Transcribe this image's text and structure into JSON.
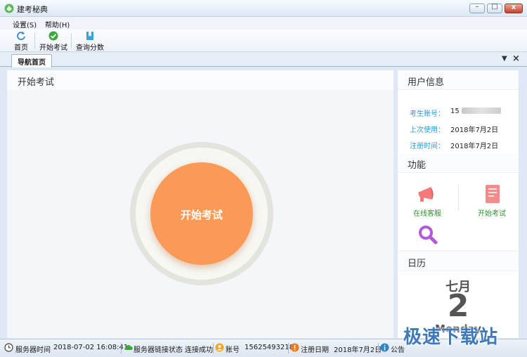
{
  "window": {
    "title": "建考秘典"
  },
  "menu": [
    {
      "label": "设置(S)"
    },
    {
      "label": "帮助(H)"
    }
  ],
  "toolbar": [
    {
      "label": "首页",
      "icon": "refresh-icon"
    },
    {
      "label": "开始考试",
      "icon": "check-circle-icon"
    },
    {
      "label": "查询分数",
      "icon": "bookmark-icon"
    }
  ],
  "tabs": [
    {
      "label": "导航首页",
      "active": true
    }
  ],
  "main": {
    "title": "开始考试",
    "start_button": "开始考试"
  },
  "user_info": {
    "title": "用户信息",
    "rows": [
      {
        "label": "考生账号：",
        "value": "15"
      },
      {
        "label": "上次使用：",
        "value": "2018年7月2日"
      },
      {
        "label": "注册时间：",
        "value": "2018年7月2日"
      }
    ]
  },
  "functions": {
    "title": "功能",
    "items": [
      {
        "label": "在线客服",
        "icon": "megaphone-icon"
      },
      {
        "label": "开始考试",
        "icon": "document-icon"
      },
      {
        "label": "",
        "icon": "search-icon"
      }
    ]
  },
  "calendar": {
    "title": "日历",
    "month": "七月",
    "day": "2",
    "weekday": "Monday"
  },
  "status": {
    "server_time_label": "服务器时间",
    "server_time": "2018-07-02 16:08:41",
    "link_label": "服务器链接状态",
    "link_value": "连接成功",
    "account_label": "账号",
    "account": "15625493218",
    "reg_label": "注册日期",
    "reg_date": "2018年7月2日",
    "notice_label": "公告"
  },
  "watermark": "极速下载站",
  "colors": {
    "accent_orange": "#fb9a57",
    "info_label": "#2a9ad6",
    "function_label": "#2a9a2a"
  }
}
